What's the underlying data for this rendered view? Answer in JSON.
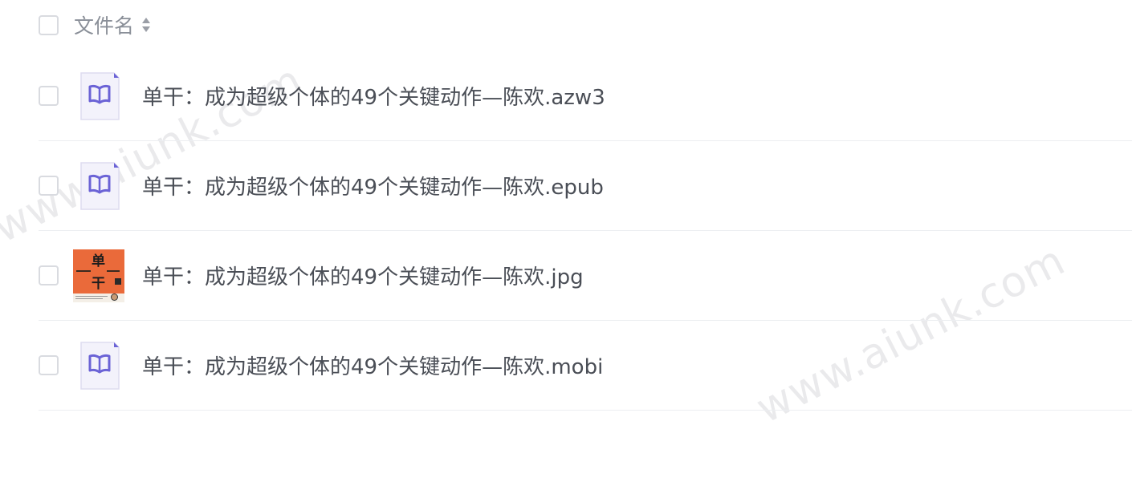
{
  "header": {
    "column_label": "文件名"
  },
  "files": [
    {
      "name": "单干：成为超级个体的49个关键动作—陈欢.azw3",
      "type": "book"
    },
    {
      "name": "单干：成为超级个体的49个关键动作—陈欢.epub",
      "type": "book"
    },
    {
      "name": "单干：成为超级个体的49个关键动作—陈欢.jpg",
      "type": "image",
      "thumb_text_top": "单",
      "thumb_text_bottom": "干"
    },
    {
      "name": "单干：成为超级个体的49个关键动作—陈欢.mobi",
      "type": "book"
    }
  ],
  "watermarks": [
    "www.aiunk.com",
    "www.aiunk.com"
  ],
  "colors": {
    "icon_accent": "#6b63d6",
    "icon_bg": "#f3f2fb",
    "thumb_bg": "#ea6a3a"
  }
}
